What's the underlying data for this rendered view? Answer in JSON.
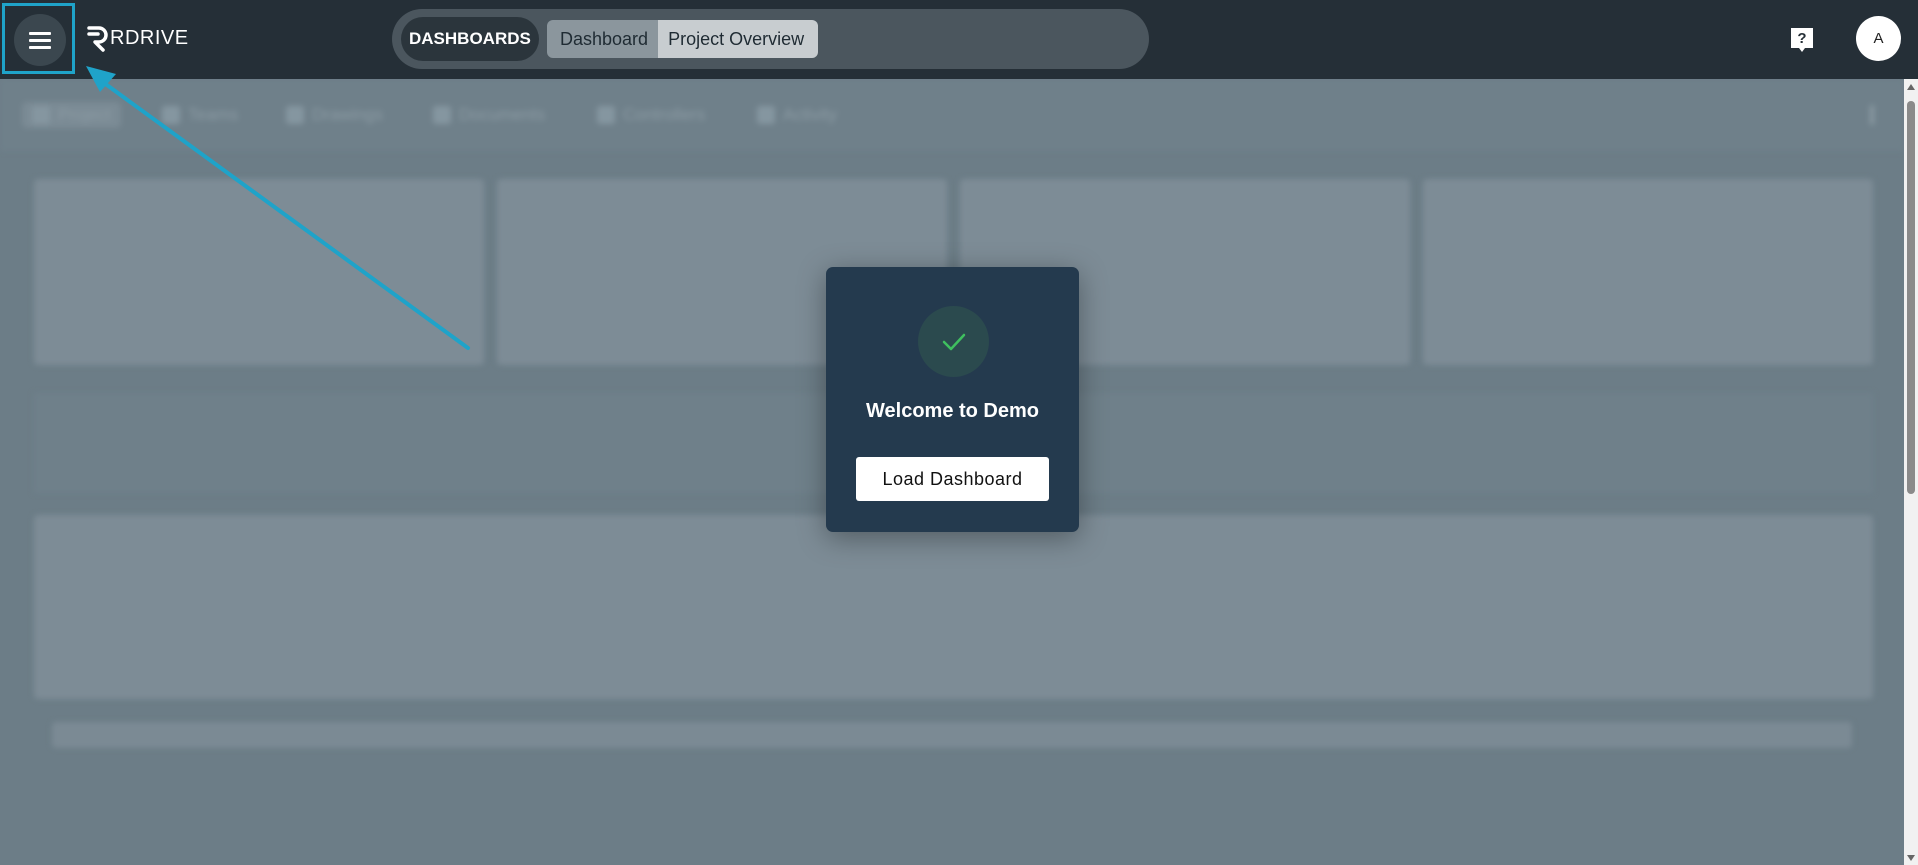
{
  "app": {
    "brand": "RDRIVE",
    "section_label": "DASHBOARDS",
    "tabs": [
      "Dashboard",
      "Project Overview"
    ],
    "user_initial": "A"
  },
  "toolbar": {
    "items": [
      "Project",
      "Teams",
      "Drawings",
      "Documents",
      "Controllers",
      "Activity"
    ]
  },
  "modal": {
    "title": "Welcome to Demo",
    "button_label": "Load Dashboard"
  },
  "colors": {
    "topbar": "#252f37",
    "annotation": "#1fa3c9",
    "modal_bg": "#243a4e",
    "check": "#3fbf5f"
  },
  "icons": [
    "menu-icon",
    "logo-mark-icon",
    "help-icon",
    "check-icon",
    "kebab-menu-icon"
  ]
}
